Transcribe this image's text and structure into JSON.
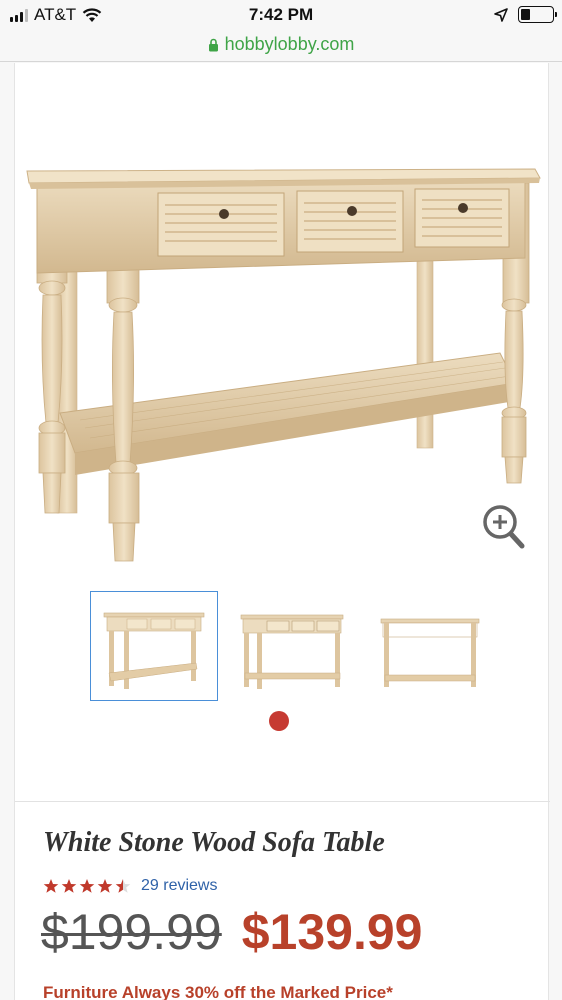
{
  "status_bar": {
    "carrier": "AT&T",
    "time": "7:42 PM"
  },
  "browser": {
    "url": "hobbylobby.com"
  },
  "product": {
    "title": "White Stone Wood Sofa Table",
    "rating": 4.5,
    "rating_max": 5,
    "reviews_label": "29 reviews",
    "old_price": "$199.99",
    "new_price": "$139.99",
    "promo": "Furniture Always 30% off the Marked Price*"
  },
  "gallery": {
    "thumbnails": [
      "front view",
      "angled view",
      "back view"
    ],
    "active_index": 0
  },
  "colors": {
    "accent_green": "#3fa447",
    "price_red": "#b8412a",
    "star_red": "#c0392b",
    "thumb_border": "#4a8fd8",
    "wood": "#e8d5b3"
  }
}
